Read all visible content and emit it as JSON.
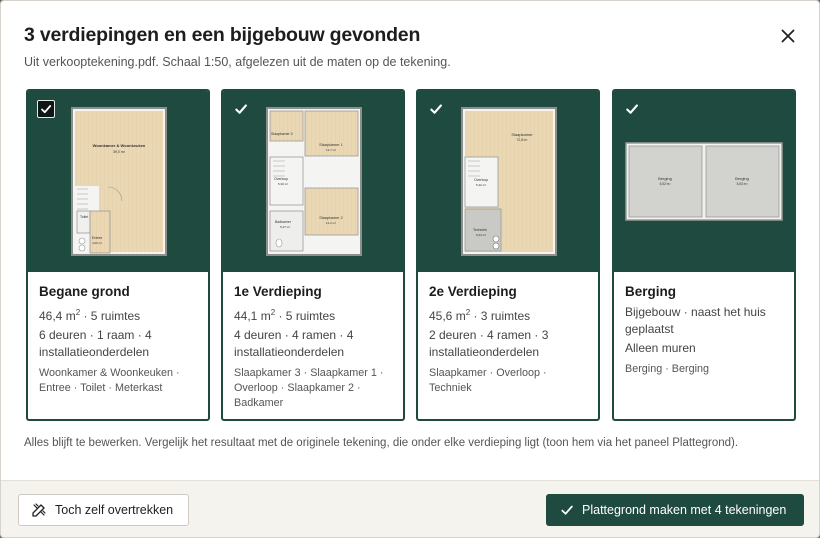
{
  "dialog": {
    "title": "3 verdiepingen en een bijgebouw gevonden",
    "subtitle": "Uit verkooptekening.pdf. Schaal 1:50, afgelezen uit de maten op de tekening.",
    "note": "Alles blijft te bewerken. Vergelijk het resultaat met de originele tekening, die onder elke verdieping ligt (toon hem via het paneel Plattegrond).",
    "icons": {
      "close": "close-icon",
      "check": "check-icon",
      "trace": "pencil-ruler-icon"
    }
  },
  "cards": [
    {
      "title": "Begane grond",
      "area": "46,4 m",
      "area_unit_sup": "2",
      "rooms_count": " · 5 ruimtes",
      "details": "6 deuren · 1 raam · 4 installatieonderdelen",
      "rooms": "Woonkamer & Woonkeuken · Entree · Toilet · Meterkast",
      "checked": true,
      "plan_labels": {
        "main": "Woonkamer & Woonkeuken",
        "main_area": "39,0 m²",
        "toilet": "Toilet",
        "entree": "Entree",
        "entree_area": "4,00 m²"
      }
    },
    {
      "title": "1e Verdieping",
      "area": "44,1 m",
      "area_unit_sup": "2",
      "rooms_count": " · 5 ruimtes",
      "details": "4 deuren · 4 ramen · 4 installatieonderdelen",
      "rooms": "Slaapkamer 3 · Slaapkamer 1 · Overloop · Slaapkamer 2 · Badkamer",
      "checked": true,
      "plan_labels": {
        "sk3": "Slaapkamer 3",
        "sk1": "Slaapkamer 1",
        "sk1_area": "13,7 m²",
        "overloop": "Overloop",
        "overloop_area": "5,30 m²",
        "badkamer": "Badkamer",
        "badkamer_area": "5,47 m²",
        "sk2": "Slaapkamer 2",
        "sk2_area": "12,2 m²"
      }
    },
    {
      "title": "2e Verdieping",
      "area": "45,6 m",
      "area_unit_sup": "2",
      "rooms_count": " · 3 ruimtes",
      "details": "2 deuren · 4 ramen · 3 installatieonderdelen",
      "rooms": "Slaapkamer · Overloop · Techniek",
      "checked": true,
      "plan_labels": {
        "sk": "Slaapkamer",
        "sk_area": "72,8 m²",
        "overloop": "Overloop",
        "overloop_area": "5,42 m²",
        "techniek": "Techniek",
        "techniek_area": "6,04 m²"
      }
    },
    {
      "title": "Berging",
      "area": "Bijgebouw · naast het huis geplaatst",
      "area_unit_sup": "",
      "rooms_count": "",
      "details": "Alleen muren",
      "rooms": "Berging · Berging",
      "checked": true,
      "plan_labels": {
        "b1": "Berging",
        "b1_area": "5,52 m²",
        "b2": "Berging",
        "b2_area": "5,53 m²"
      }
    }
  ],
  "footer": {
    "secondary_label": "Toch zelf overtrekken",
    "primary_label": "Plattegrond maken met 4 tekeningen"
  },
  "colors": {
    "accent": "#1f4a3f",
    "floor": "#e8d6b3",
    "wall": "#9a9a96"
  }
}
